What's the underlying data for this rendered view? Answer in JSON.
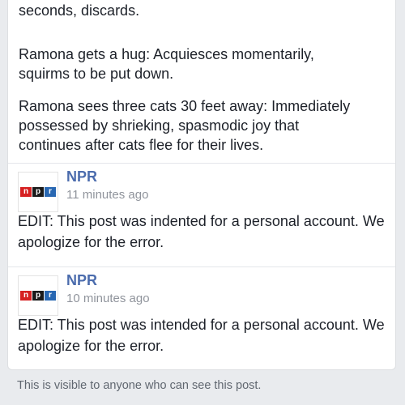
{
  "post": {
    "paragraphs": [
      "seconds, discards.",
      "Ramona gets a hug: Acquiesces momentarily,\nsquirms to be put down.",
      "Ramona sees three cats 30 feet away: Immediately\npossessed by shrieking, spasmodic joy that\ncontinues after cats flee for their lives."
    ]
  },
  "comments": [
    {
      "logo_letters": [
        "n",
        "p",
        "r"
      ],
      "author": "NPR",
      "time": "11 minutes ago",
      "text": "EDIT: This post was indented for a personal account. We apologize for the error."
    },
    {
      "logo_letters": [
        "n",
        "p",
        "r"
      ],
      "author": "NPR",
      "time": "10 minutes ago",
      "text": "EDIT: This post was intended for a personal account. We apologize for the error."
    }
  ],
  "footer": {
    "privacy_text": "This is visible to anyone who can see this post."
  },
  "colors": {
    "npr_n": "#d62021",
    "npr_p": "#1a1a1a",
    "npr_r": "#2867b2",
    "author_link": "#4b6cad"
  }
}
